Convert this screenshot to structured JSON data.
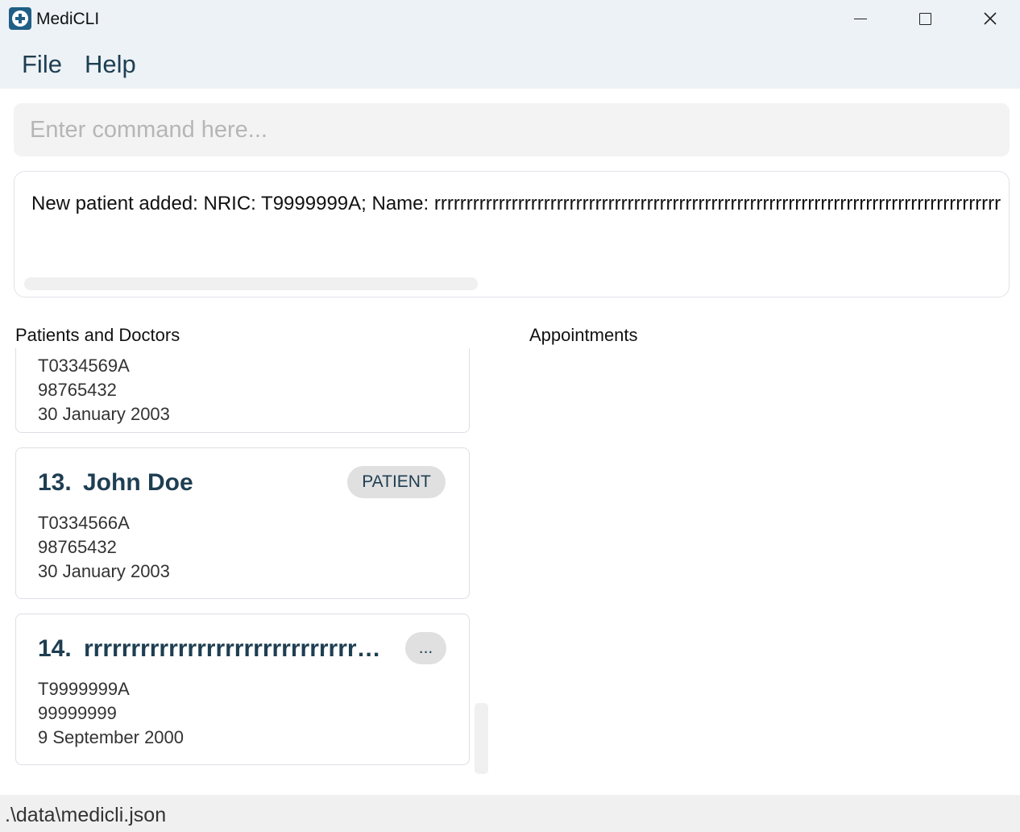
{
  "window": {
    "title": "MediCLI",
    "icon": "medical-cross-icon"
  },
  "menu": {
    "file": "File",
    "help": "Help"
  },
  "command": {
    "placeholder": "Enter command here...",
    "value": ""
  },
  "result": {
    "text": "New patient added: NRIC: T9999999A; Name: rrrrrrrrrrrrrrrrrrrrrrrrrrrrrrrrrrrrrrrrrrrrrrrrrrrrrrrrrrrrrrrrrrrrrrrrrrrrrrrrrrrrrrrr"
  },
  "sections": {
    "patients_doctors": "Patients and Doctors",
    "appointments": "Appointments"
  },
  "persons": [
    {
      "nric": "T0334569A",
      "phone": "98765432",
      "dob": "30 January 2003"
    },
    {
      "index": "13.",
      "name": "John Doe",
      "badge": "PATIENT",
      "nric": "T0334566A",
      "phone": "98765432",
      "dob": "30 January 2003"
    },
    {
      "index": "14.",
      "name": "rrrrrrrrrrrrrrrrrrrrrrrrrrrrrrrrrrrrrrrrrrrrrrrr",
      "badge": "...",
      "nric": "T9999999A",
      "phone": "99999999",
      "dob": "9 September 2000"
    }
  ],
  "status": {
    "file_path": ".\\data\\medicli.json"
  },
  "colors": {
    "titlebar": "#edf2f6",
    "accent_text": "#1e3e52",
    "badge_bg": "#e0e0e0"
  }
}
